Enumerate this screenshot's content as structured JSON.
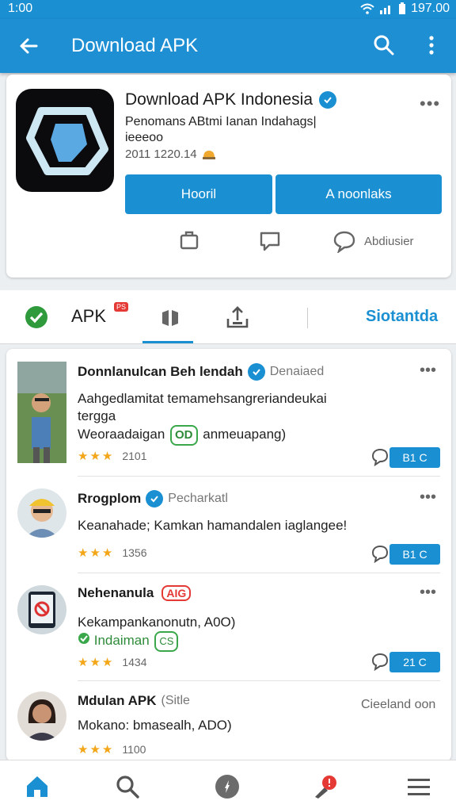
{
  "status_bar": {
    "time": "1:00",
    "battery": "197.00"
  },
  "app_bar": {
    "title": "Download APK",
    "back_icon": "arrow-left-icon",
    "search_icon": "search-icon",
    "more_icon": "more-vertical-icon"
  },
  "app_card": {
    "name": "Download APK Indonesia",
    "description": "Penomans ABtmi Ianan Indahags|",
    "description_line2": "ieeeoo",
    "meta": "2011 1220.14",
    "install_label": "Hooril",
    "download_label": "A noonlaks",
    "actions": [
      {
        "icon": "share-icon",
        "label": ""
      },
      {
        "icon": "chat-icon",
        "label": ""
      },
      {
        "icon": "comment-icon",
        "label": "Abdiusier"
      }
    ]
  },
  "tabs": {
    "apk_label": "APK",
    "apk_badge": "PS",
    "right_label": "Siotantda"
  },
  "list": [
    {
      "name": "Donnlanulcan Beh lendah",
      "sub": "Denaiaed",
      "text_line1": "Aahgedlamitat temamehsangreriandeukai",
      "text_line2": "tergga",
      "text_line3a": "Weoraadaigan",
      "text_badge": "OD",
      "text_line3b": "anmeuapang)",
      "rating": "2101",
      "pill": "B1 C"
    },
    {
      "name": "Rrogplom",
      "sub": "Pecharkatl",
      "text_line1": "Keanahade; Kamkan hamandalen iaglangee!",
      "rating": "1356",
      "pill": "B1 C"
    },
    {
      "name": "Nehenanula",
      "name_badge": "AIG",
      "text_line1": "Kekampankanonutn, A0O)",
      "text_line2": "Indaiman",
      "text_line2_badge": "CS",
      "rating": "1434",
      "pill": "21 C"
    },
    {
      "name": "Mdulan APK",
      "sub": "(Sitle",
      "right": "Cieeland oon",
      "text_line1": "Mokano: bmasealh, ADO)",
      "rating": "1100"
    }
  ],
  "bottom_nav": [
    "home-icon",
    "search-icon",
    "compass-icon",
    "notification-icon",
    "menu-icon"
  ],
  "colors": {
    "primary": "#1a8fd2",
    "star": "#f2a618",
    "badge_red": "#e53935",
    "badge_green": "#3aa84a"
  }
}
